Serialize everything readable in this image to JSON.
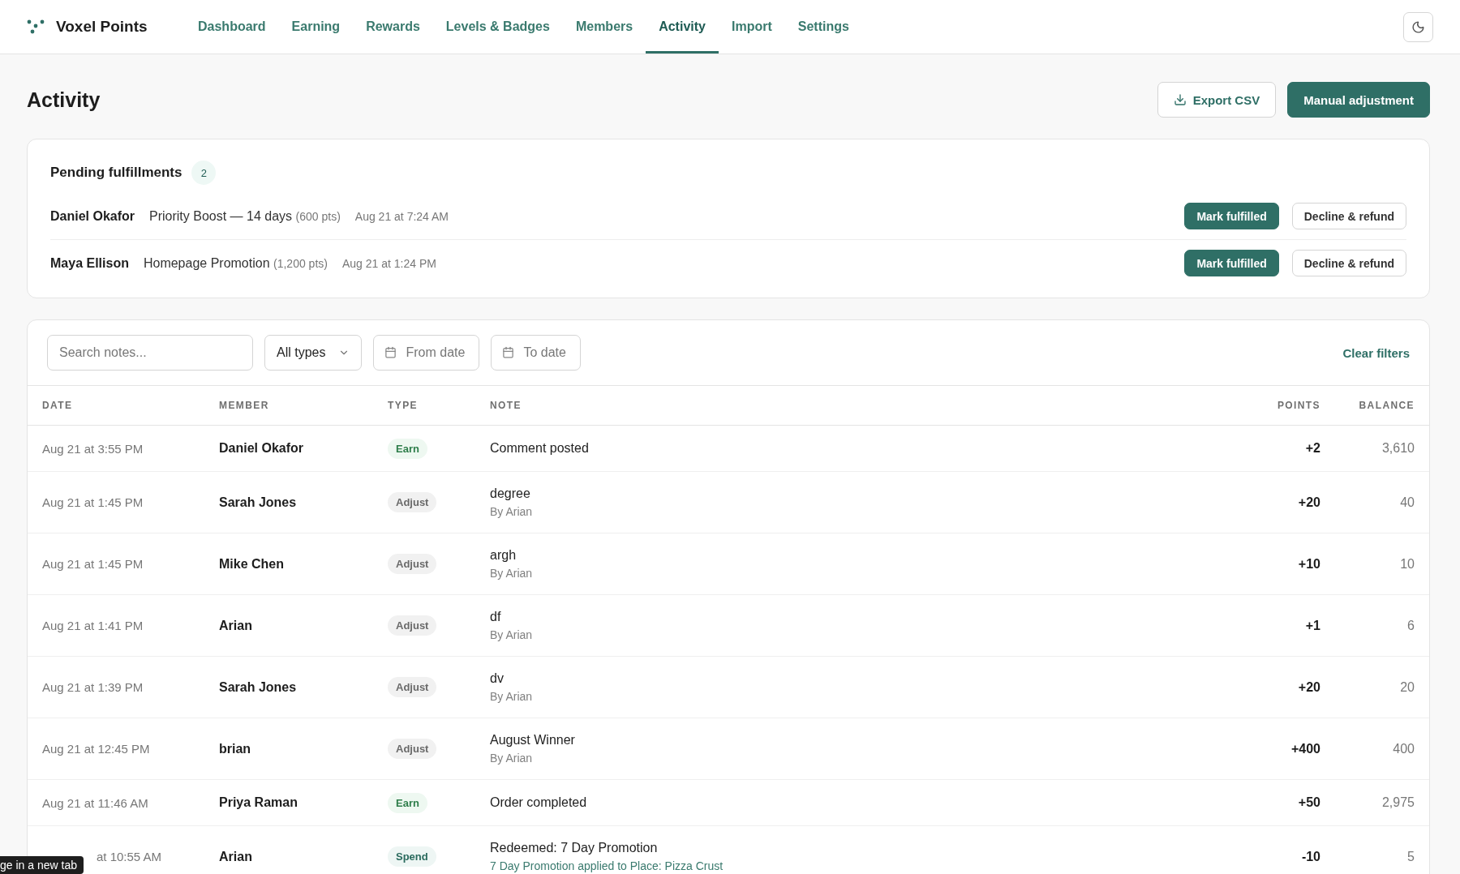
{
  "app": {
    "name": "Voxel Points"
  },
  "nav": [
    {
      "label": "Dashboard",
      "selected": false
    },
    {
      "label": "Earning",
      "selected": false
    },
    {
      "label": "Rewards",
      "selected": false
    },
    {
      "label": "Levels & Badges",
      "selected": false
    },
    {
      "label": "Members",
      "selected": false
    },
    {
      "label": "Activity",
      "selected": true
    },
    {
      "label": "Import",
      "selected": false
    },
    {
      "label": "Settings",
      "selected": false
    }
  ],
  "page": {
    "title": "Activity",
    "buttons": [
      {
        "label": "Export CSV",
        "kind": "secondary"
      },
      {
        "label": "Manual adjustment",
        "kind": "primary"
      }
    ]
  },
  "pending": {
    "title": "Pending fulfillments",
    "count": "2",
    "items": [
      {
        "member": "Daniel Okafor",
        "reward": "Priority Boost — 14 days",
        "cost": "(600 pts)",
        "time": "Aug 21 at 7:24 AM",
        "actions": [
          "Mark fulfilled",
          "Decline & refund"
        ]
      },
      {
        "member": "Maya Ellison",
        "reward": "Homepage Promotion",
        "cost": "(1,200 pts)",
        "time": "Aug 21 at 1:24 PM",
        "actions": [
          "Mark fulfilled",
          "Decline & refund"
        ]
      }
    ]
  },
  "filters": {
    "search": {
      "placeholder": "Search notes..."
    },
    "type": "All types",
    "from": {
      "placeholder": "From date"
    },
    "to": {
      "placeholder": "To date"
    },
    "clear": "Clear filters"
  },
  "table": {
    "columns": [
      "DATE",
      "MEMBER",
      "TYPE",
      "NOTE",
      "POINTS",
      "BALANCE"
    ],
    "rows": [
      {
        "date": "Aug 21 at 3:55 PM",
        "member": "Daniel Okafor",
        "type": {
          "label": "Earn",
          "kind": "earn"
        },
        "note": "Comment posted",
        "points": "+2",
        "balance": "3,610"
      },
      {
        "date": "Aug 21 at 1:45 PM",
        "member": "Sarah Jones",
        "type": {
          "label": "Adjust",
          "kind": "adjust"
        },
        "note": "degree",
        "sub": {
          "text": "By Arian",
          "kind": "author"
        },
        "points": "+20",
        "balance": "40"
      },
      {
        "date": "Aug 21 at 1:45 PM",
        "member": "Mike Chen",
        "type": {
          "label": "Adjust",
          "kind": "adjust"
        },
        "note": "argh",
        "sub": {
          "text": "By Arian",
          "kind": "author"
        },
        "points": "+10",
        "balance": "10"
      },
      {
        "date": "Aug 21 at 1:41 PM",
        "member": "Arian",
        "type": {
          "label": "Adjust",
          "kind": "adjust"
        },
        "note": "df",
        "sub": {
          "text": "By Arian",
          "kind": "author"
        },
        "points": "+1",
        "balance": "6"
      },
      {
        "date": "Aug 21 at 1:39 PM",
        "member": "Sarah Jones",
        "type": {
          "label": "Adjust",
          "kind": "adjust"
        },
        "note": "dv",
        "sub": {
          "text": "By Arian",
          "kind": "author"
        },
        "points": "+20",
        "balance": "20"
      },
      {
        "date": "Aug 21 at 12:45 PM",
        "member": "brian",
        "type": {
          "label": "Adjust",
          "kind": "adjust"
        },
        "note": "August Winner",
        "sub": {
          "text": "By Arian",
          "kind": "author"
        },
        "points": "+400",
        "balance": "400"
      },
      {
        "date": "Aug 21 at 11:46 AM",
        "member": "Priya Raman",
        "type": {
          "label": "Earn",
          "kind": "earn"
        },
        "note": "Order completed",
        "points": "+50",
        "balance": "2,975"
      },
      {
        "date": "at 10:55 AM",
        "covered": true,
        "member": "Arian",
        "type": {
          "label": "Spend",
          "kind": "spend"
        },
        "note": "Redeemed: 7 Day Promotion",
        "sub": {
          "text": "7 Day Promotion applied to Place: Pizza Crust",
          "kind": "link"
        },
        "points": "-10",
        "balance": "5"
      }
    ]
  },
  "tooltip": "ge in a new tab"
}
